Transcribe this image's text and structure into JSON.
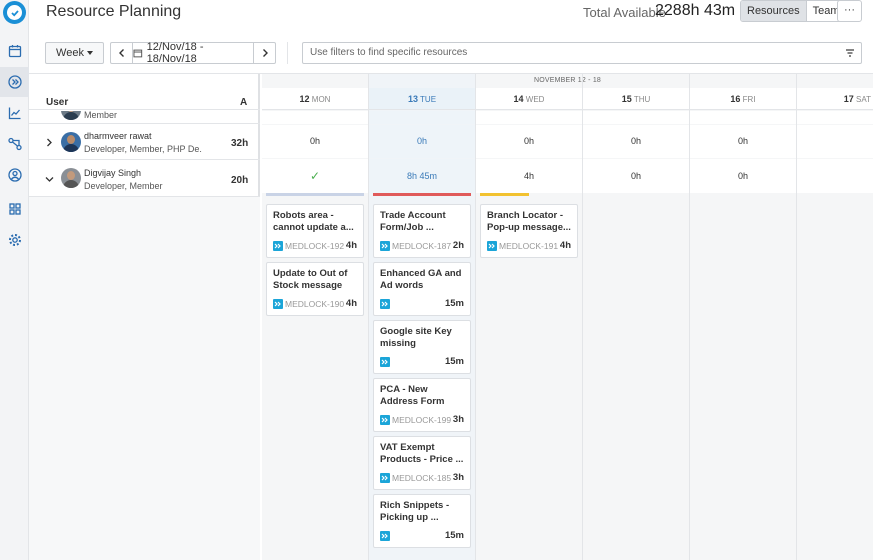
{
  "header": {
    "title": "Resource Planning",
    "total_label": "Total Available",
    "total_value": "2288h 43m",
    "view_tabs": [
      "Resources",
      "Team"
    ],
    "more_label": "···"
  },
  "toolbar": {
    "period": "Week",
    "date_range": "12/Nov/18 - 18/Nov/18",
    "filter_placeholder": "Use filters to find specific resources"
  },
  "grid": {
    "user_header": "User",
    "a_header": "A",
    "week_label": "NOVEMBER 12 - 18",
    "days": [
      {
        "num": "12",
        "dow": "MON"
      },
      {
        "num": "13",
        "dow": "TUE"
      },
      {
        "num": "14",
        "dow": "WED"
      },
      {
        "num": "15",
        "dow": "THU"
      },
      {
        "num": "16",
        "dow": "FRI"
      },
      {
        "num": "17",
        "dow": "SAT"
      }
    ]
  },
  "users": [
    {
      "name": "",
      "role": "Member",
      "hours": ""
    },
    {
      "name": "dharmveer rawat",
      "role": "Developer, Member, PHP De.",
      "hours": "32h",
      "days": [
        "0h",
        "0h",
        "0h",
        "0h",
        "0h",
        ""
      ]
    },
    {
      "name": "Digvijay Singh",
      "role": "Developer, Member",
      "hours": "20h",
      "days": [
        "✓",
        "8h 45m",
        "4h",
        "0h",
        "0h",
        ""
      ]
    }
  ],
  "colors": {
    "accent": "#1a8fd6",
    "tag": "#1ba5d8",
    "bar_mon": "#c9d3e6",
    "bar_tue": "#e05a5a",
    "bar_wed": "#f2c230",
    "check": "#4caf50"
  },
  "tasks": {
    "mon": [
      {
        "title": "Robots area - cannot update a...",
        "key": "MEDLOCK-192",
        "hours": "4h"
      },
      {
        "title": "Update to Out of Stock message",
        "key": "MEDLOCK-190",
        "hours": "4h"
      }
    ],
    "tue": [
      {
        "title": "Trade Account Form/Job ...",
        "key": "MEDLOCK-187",
        "hours": "2h"
      },
      {
        "title": "Enhanced GA and Ad words",
        "key": "",
        "hours": "15m"
      },
      {
        "title": "Google site Key missing",
        "key": "",
        "hours": "15m"
      },
      {
        "title": "PCA - New Address Form",
        "key": "MEDLOCK-199",
        "hours": "3h"
      },
      {
        "title": "VAT Exempt Products - Price ...",
        "key": "MEDLOCK-185",
        "hours": "3h"
      },
      {
        "title": "Rich Snippets - Picking up ...",
        "key": "",
        "hours": "15m"
      }
    ],
    "wed": [
      {
        "title": "Branch Locator - Pop-up message...",
        "key": "MEDLOCK-191",
        "hours": "4h"
      }
    ]
  }
}
